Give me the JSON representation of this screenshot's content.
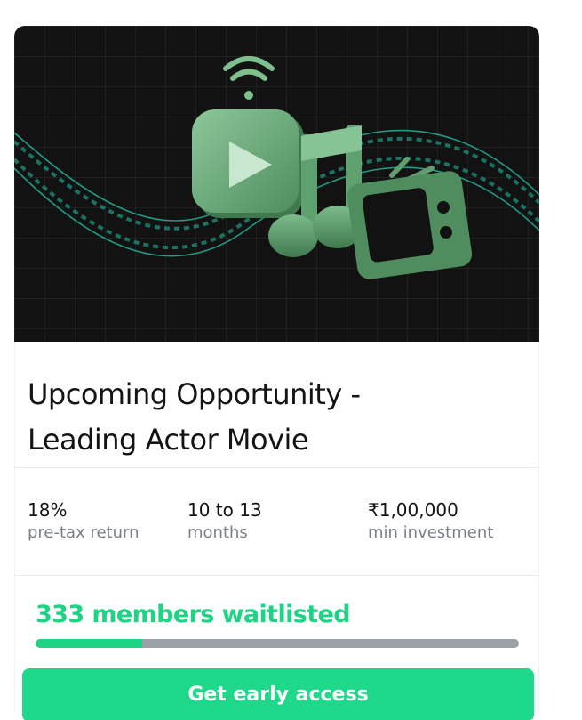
{
  "card": {
    "title_line1": "Upcoming Opportunity -",
    "title_line2": "Leading Actor Movie",
    "hero_icons": [
      "wifi-icon",
      "play-icon",
      "music-note-icon",
      "tv-icon",
      "film-strip-icon"
    ]
  },
  "stats": [
    {
      "value": "18%",
      "label": "pre-tax return"
    },
    {
      "value": "10 to 13",
      "label": "months"
    },
    {
      "value": "₹1,00,000",
      "label": "min investment"
    }
  ],
  "waitlist": {
    "text": "333 members waitlisted",
    "progress_fraction": 0.22,
    "button_label": "Get early access"
  },
  "colors": {
    "accent": "#1ed98a",
    "accent_text": "#1fd385",
    "hero_bg": "#121212",
    "icon_green": "#6fae7c",
    "muted": "#7b8088"
  }
}
